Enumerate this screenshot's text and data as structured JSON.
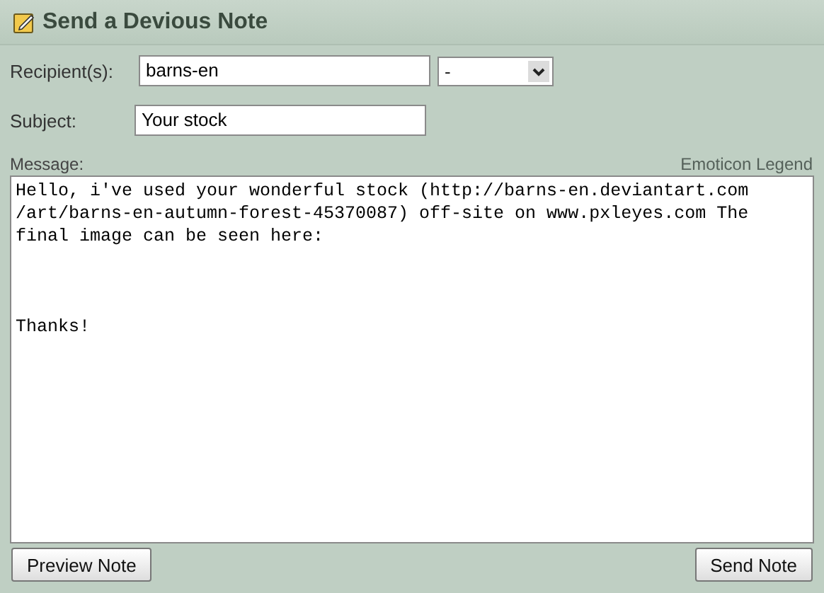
{
  "title": "Send a Devious Note",
  "recipient": {
    "label": "Recipient(s):",
    "value": "barns-en",
    "dropdown": "-"
  },
  "subject": {
    "label": "Subject:",
    "value": "Your stock"
  },
  "message": {
    "label": "Message:",
    "legend_link": "Emoticon Legend",
    "value": "Hello, i've used your wonderful stock (http://barns-en.deviantart.com\n/art/barns-en-autumn-forest-45370087) off-site on www.pxleyes.com The\nfinal image can be seen here:\n\n\n\nThanks!"
  },
  "buttons": [
    "Preview Note",
    "Send Note"
  ]
}
